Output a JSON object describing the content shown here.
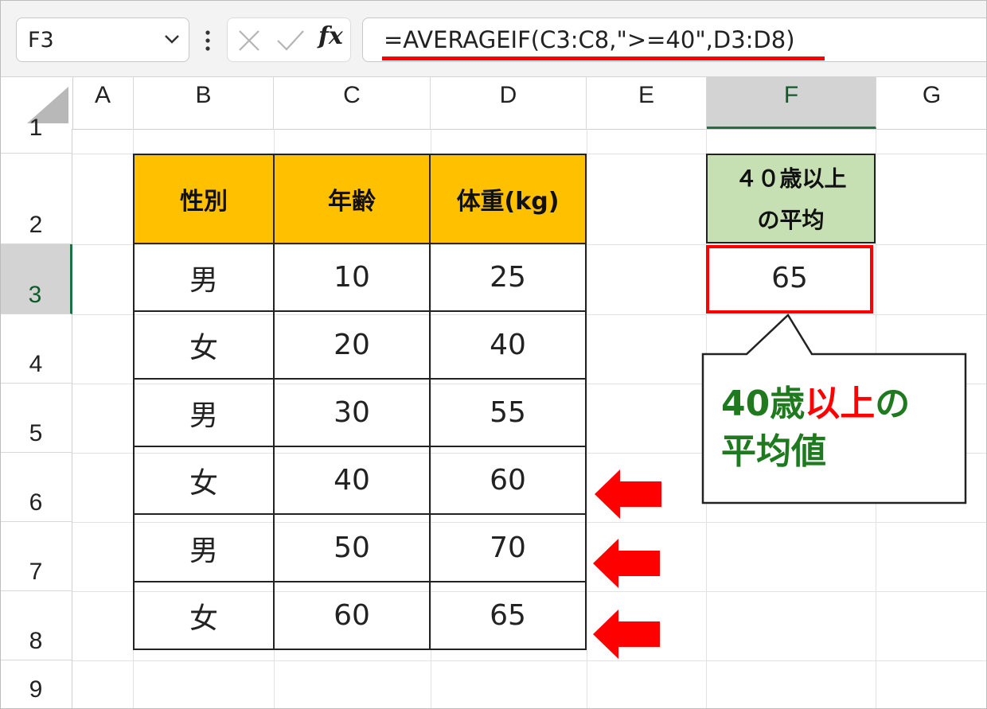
{
  "formula_bar": {
    "name_box": "F3",
    "formula": "=AVERAGEIF(C3:C8,\">=40\",D3:D8)",
    "fx_label": "fx"
  },
  "columns": [
    "A",
    "B",
    "C",
    "D",
    "E",
    "F",
    "G"
  ],
  "rows": [
    "1",
    "2",
    "3",
    "4",
    "5",
    "6",
    "7",
    "8",
    "9"
  ],
  "table": {
    "headers": [
      "性別",
      "年齢",
      "体重(kg)"
    ],
    "rows": [
      [
        "男",
        "10",
        "25"
      ],
      [
        "女",
        "20",
        "40"
      ],
      [
        "男",
        "30",
        "55"
      ],
      [
        "女",
        "40",
        "60"
      ],
      [
        "男",
        "50",
        "70"
      ],
      [
        "女",
        "60",
        "65"
      ]
    ]
  },
  "result": {
    "header_line1": "４０歳以上",
    "header_line2": "の平均",
    "value": "65"
  },
  "callout": {
    "part1": "40歳",
    "part2": "以上",
    "part3": "の",
    "line2": "平均値"
  },
  "colors": {
    "header_fill": "#ffc000",
    "result_header_fill": "#c6e0b4",
    "highlight": "#ff0000",
    "callout_text": "#1f7a1f",
    "selection": "#1e7145"
  }
}
